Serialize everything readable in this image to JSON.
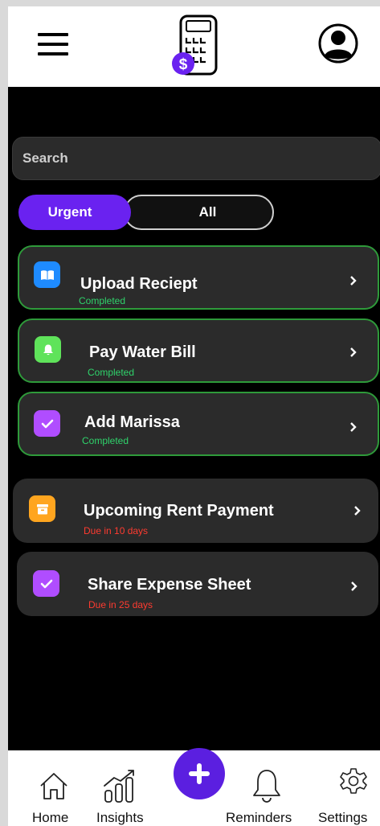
{
  "search": {
    "placeholder": "Search"
  },
  "tabs": [
    {
      "label": "Urgent",
      "active": true
    },
    {
      "label": "All",
      "active": false
    }
  ],
  "tasks": [
    {
      "title": "Upload Reciept",
      "status": "Completed",
      "icon": "book-icon",
      "color": "#1e8bff"
    },
    {
      "title": "Pay Water Bill",
      "status": "Completed",
      "icon": "bell-icon",
      "color": "#5fe35a"
    },
    {
      "title": "Add Marissa",
      "status": "Completed",
      "icon": "check-icon",
      "color": "#b04dff"
    },
    {
      "title": "Upcoming Rent Payment",
      "status": "Due in 10 days",
      "icon": "archive-icon",
      "color": "#ffa51f"
    },
    {
      "title": "Share Expense Sheet",
      "status": "Due in 25 days",
      "icon": "check-icon",
      "color": "#b04dff"
    }
  ],
  "nav": [
    {
      "label": "Home",
      "icon": "home-icon"
    },
    {
      "label": "Insights",
      "icon": "chart-icon"
    },
    {
      "label": "Reminders",
      "icon": "bell-icon"
    },
    {
      "label": "Settings",
      "icon": "gear-icon"
    }
  ],
  "logo": {
    "badge": "$"
  },
  "colors": {
    "accent": "#6a22f0",
    "completed": "#2fd36b",
    "due": "#ff3b30"
  }
}
